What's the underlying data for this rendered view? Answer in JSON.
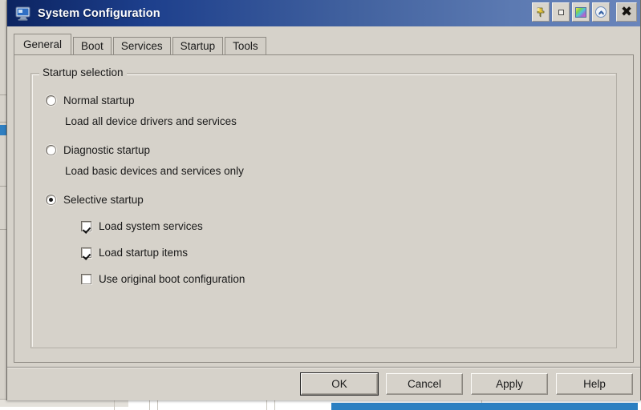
{
  "window": {
    "title": "System Configuration",
    "app_icon": "computer-monitor-icon",
    "titlebar_color": "#1d3f8c",
    "controls": [
      {
        "name": "pin-button",
        "icon": "pushpin-icon",
        "label": ""
      },
      {
        "name": "minimize-button",
        "icon": "small-square-icon",
        "label": ""
      },
      {
        "name": "display-color-button",
        "icon": "rainbow-square-icon",
        "label": ""
      },
      {
        "name": "collapse-button",
        "icon": "circle-chevron-up-icon",
        "label": ""
      },
      {
        "name": "close-button",
        "icon": "close-x-icon",
        "label": "✖"
      }
    ]
  },
  "tabs": [
    {
      "label": "General",
      "active": true
    },
    {
      "label": "Boot",
      "active": false
    },
    {
      "label": "Services",
      "active": false
    },
    {
      "label": "Startup",
      "active": false
    },
    {
      "label": "Tools",
      "active": false
    }
  ],
  "general": {
    "group_label": "Startup selection",
    "options": [
      {
        "label": "Normal startup",
        "selected": false,
        "description": "Load all device drivers and services"
      },
      {
        "label": "Diagnostic startup",
        "selected": false,
        "description": "Load basic devices and services only"
      },
      {
        "label": "Selective startup",
        "selected": true,
        "description": ""
      }
    ],
    "checkboxes": [
      {
        "label": "Load system services",
        "checked": true
      },
      {
        "label": "Load startup items",
        "checked": true
      },
      {
        "label": "Use original boot configuration",
        "checked": false
      }
    ]
  },
  "footer": {
    "buttons": [
      {
        "label": "OK",
        "default": true
      },
      {
        "label": "Cancel",
        "default": false
      },
      {
        "label": "Apply",
        "default": false
      },
      {
        "label": "Help",
        "default": false
      }
    ]
  }
}
